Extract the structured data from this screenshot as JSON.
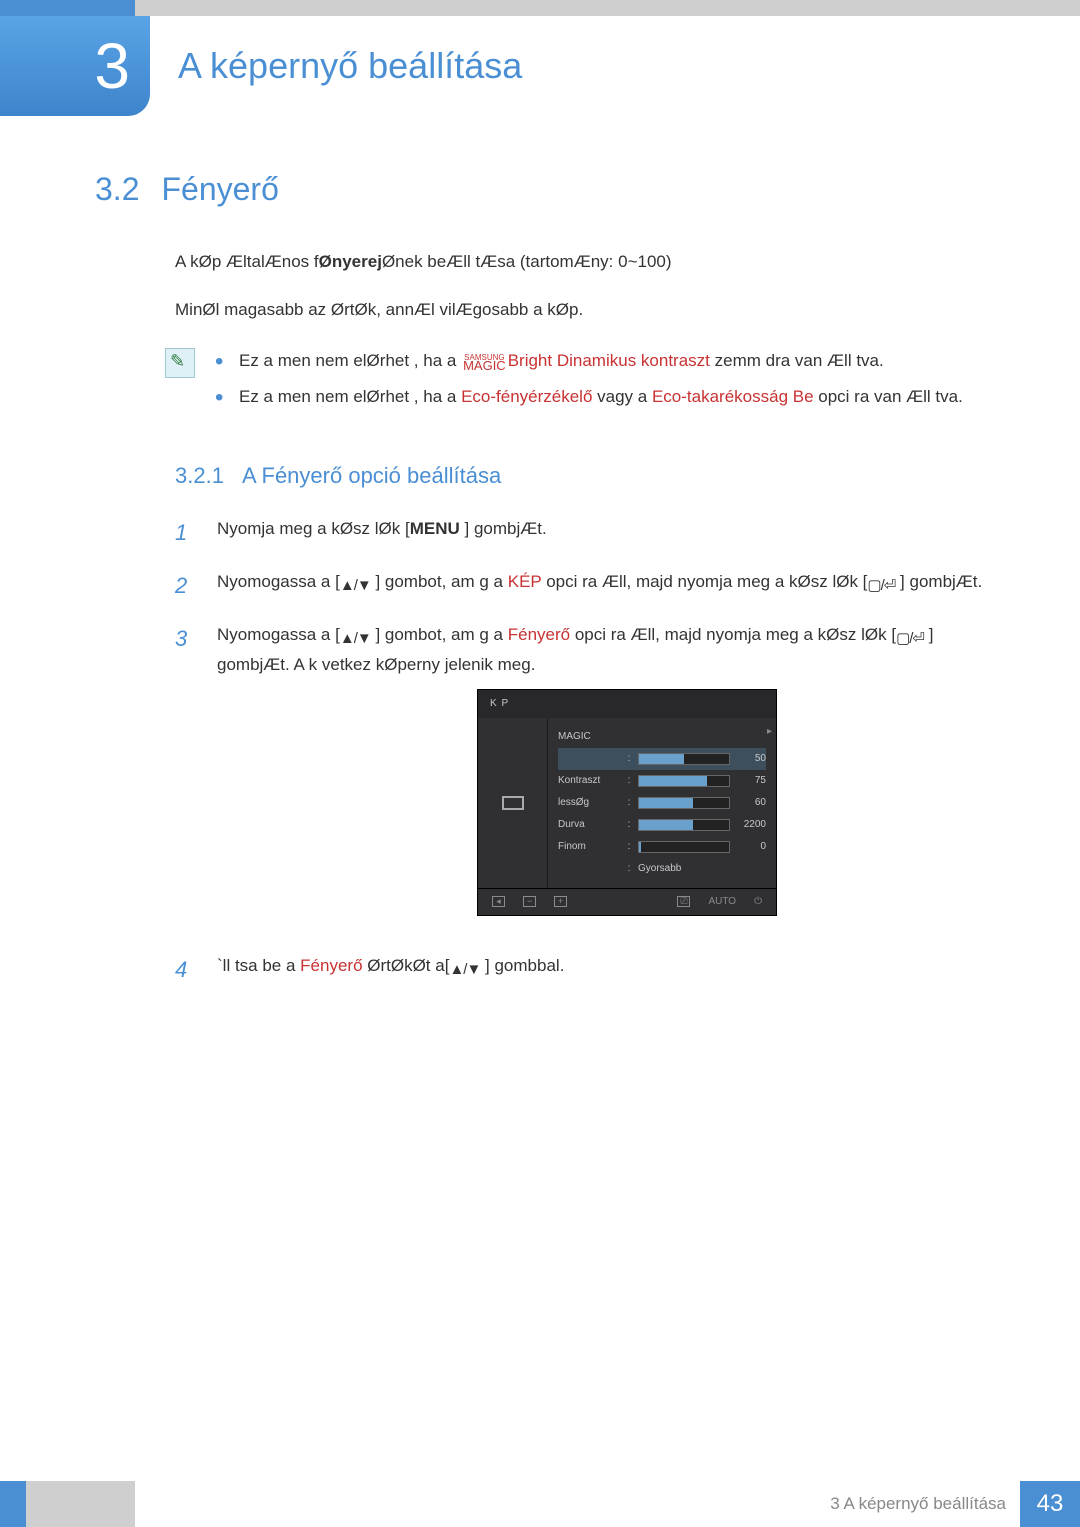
{
  "chapter": {
    "number": "3",
    "title": "A képernyő beállítása"
  },
  "section": {
    "number": "3.2",
    "title": "Fényerő"
  },
  "intro": {
    "line1_a": "A kØp ÆltalÆnos f",
    "line1_em": "Ønyerej",
    "line1_b": "Ønek beÆll tÆsa (tartomÆny: 0~100)",
    "line2": "MinØl magasabb az ØrtØk, annÆl vilÆgosabb a kØp."
  },
  "notes": {
    "item1_a": "Ez a men  nem elØrhet , ha a",
    "item1_magic_top": "SAMSUNG",
    "item1_magic_bot": "MAGIC",
    "item1_kw": "Bright Dinamikus kontraszt",
    "item1_b": "  zemm dra van Æll tva.",
    "item2_a": "Ez a men  nem elØrhet , ha a ",
    "item2_kw1": "Eco-fényérzékelő",
    "item2_mid": " vagy a",
    "item2_kw2": "Eco-takarékosság Be",
    "item2_b": " opci ra van Æll tva."
  },
  "subsection": {
    "number": "3.2.1",
    "title": "A Fényerő opció beállítása"
  },
  "steps": {
    "s1_a": "Nyomja meg a kØsz lØk",
    "s1_menu": "MENU",
    "s1_b": " ] gombjÆt.",
    "s2_a": "Nyomogassa a [",
    "s2_arrows": "▲/▼",
    "s2_b": " ] gombot, am g a",
    "s2_kw": "KÉP",
    "s2_c": " opci ra Æll, majd nyomja meg a kØsz lØk",
    "s2_btn": "▢/⏎",
    "s2_d": " ] gombjÆt.",
    "s3_a": "Nyomogassa a [",
    "s3_arrows": "▲/▼",
    "s3_b": " ] gombot, am g a",
    "s3_kw": "Fényerő",
    "s3_c": " opci ra Æll, majd nyomja meg a kØsz lØk",
    "s3_btn": "▢/⏎",
    "s3_d": " ] gombjÆt. A k vetkez  kØperny  jelenik meg.",
    "s4_a": "`ll tsa be a ",
    "s4_kw": "Fényerő",
    "s4_b": " ØrtØkØt a[",
    "s4_arrows": "▲/▼",
    "s4_c": " ] gombbal."
  },
  "osd": {
    "title": "K P",
    "rows": [
      {
        "label": "MAGIC",
        "value": "",
        "bar": null
      },
      {
        "label": "",
        "value": "50",
        "bar": 50,
        "selected": true
      },
      {
        "label": "Kontraszt",
        "value": "75",
        "bar": 75
      },
      {
        "label": "lessØg",
        "value": "60",
        "bar": 60
      },
      {
        "label": "Durva",
        "value": "2200",
        "bar": 60
      },
      {
        "label": "Finom",
        "value": "0",
        "bar": 2
      },
      {
        "label": "",
        "value": "Gyorsabb",
        "bar": null
      }
    ],
    "bottom_auto": "AUTO"
  },
  "footer": {
    "label": "3 A képernyő beállítása",
    "page": "43"
  }
}
